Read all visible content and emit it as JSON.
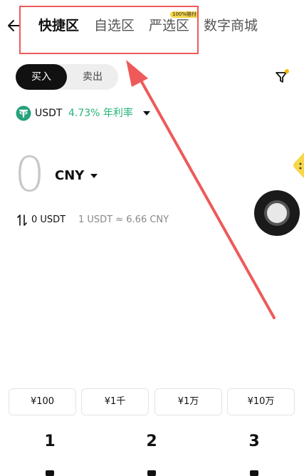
{
  "header": {
    "tabs": [
      {
        "label": "快捷区",
        "active": true
      },
      {
        "label": "自选区",
        "active": false
      },
      {
        "label": "严选区",
        "active": false,
        "badge": "100%赔付"
      },
      {
        "label": "数字商城",
        "active": false
      }
    ]
  },
  "trade_toggle": {
    "buy": "买入",
    "sell": "卖出",
    "selected": "buy"
  },
  "asset": {
    "symbol": "USDT",
    "rate": "4.73% 年利率"
  },
  "amount": {
    "value": "0",
    "currency": "CNY"
  },
  "conversion": {
    "usdt_amount": "0 USDT",
    "exchange_rate": "1 USDT ≈ 6.66 CNY"
  },
  "quick_amounts": [
    "¥100",
    "¥1千",
    "¥1万",
    "¥10万"
  ],
  "keypad": [
    "1",
    "2",
    "3"
  ],
  "colors": {
    "accent_green": "#27b47a",
    "annotation_red": "#ee5a5a",
    "badge_yellow": "#f7d64a",
    "toggle_dark": "#111111"
  },
  "icons": [
    "back-arrow-icon",
    "filter-icon",
    "usdt-coin-icon",
    "caret-down-icon",
    "swap-icon",
    "floating-assist-button"
  ]
}
